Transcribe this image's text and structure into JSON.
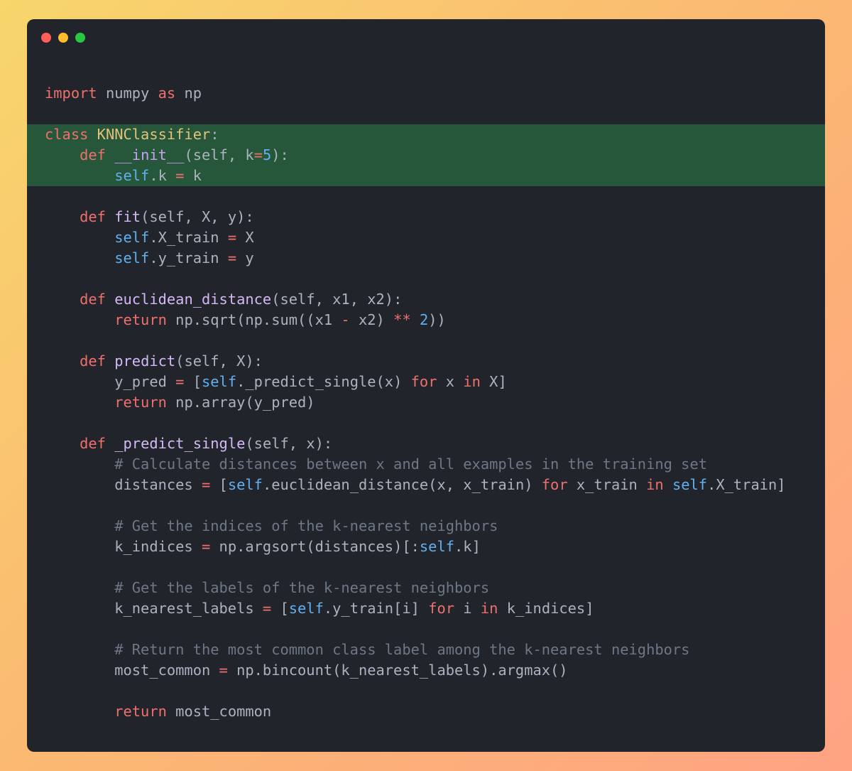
{
  "window": {
    "controls": [
      {
        "name": "close",
        "color": "#ff5f57"
      },
      {
        "name": "minimize",
        "color": "#febc2e"
      },
      {
        "name": "maximize",
        "color": "#28c840"
      }
    ]
  },
  "colors": {
    "background_gradient": [
      "#f8d66c",
      "#fbb872",
      "#ffa383"
    ],
    "window": "#21252b",
    "highlight": "#27573a",
    "keyword": "#ef6f6c",
    "self_and_numbers": "#61afef",
    "function_names": "#d4b8f5",
    "class_name": "#e5c07b",
    "comment": "#6d7785",
    "plain_text": "#abb2bf"
  },
  "code": {
    "language": "python",
    "highlighted_lines": [
      2,
      3,
      4
    ],
    "lines": [
      [
        {
          "t": "import",
          "c": "kw"
        },
        {
          "t": " numpy ",
          "c": "pl"
        },
        {
          "t": "as",
          "c": "kw"
        },
        {
          "t": " np",
          "c": "pl"
        }
      ],
      [],
      [
        {
          "t": "class",
          "c": "kw"
        },
        {
          "t": " ",
          "c": "pl"
        },
        {
          "t": "KNNClassifier",
          "c": "cls"
        },
        {
          "t": ":",
          "c": "pl"
        }
      ],
      [
        {
          "t": "    ",
          "c": "pl"
        },
        {
          "t": "def",
          "c": "kw"
        },
        {
          "t": " ",
          "c": "pl"
        },
        {
          "t": "__init__",
          "c": "dunder"
        },
        {
          "t": "(self, k",
          "c": "pl"
        },
        {
          "t": "=",
          "c": "op"
        },
        {
          "t": "5",
          "c": "num"
        },
        {
          "t": "):",
          "c": "pl"
        }
      ],
      [
        {
          "t": "        ",
          "c": "pl"
        },
        {
          "t": "self",
          "c": "self"
        },
        {
          "t": ".k ",
          "c": "pl"
        },
        {
          "t": "=",
          "c": "op"
        },
        {
          "t": " k",
          "c": "pl"
        }
      ],
      [],
      [
        {
          "t": "    ",
          "c": "pl"
        },
        {
          "t": "def",
          "c": "kw"
        },
        {
          "t": " ",
          "c": "pl"
        },
        {
          "t": "fit",
          "c": "fn"
        },
        {
          "t": "(self, X, y):",
          "c": "pl"
        }
      ],
      [
        {
          "t": "        ",
          "c": "pl"
        },
        {
          "t": "self",
          "c": "self"
        },
        {
          "t": ".X_train ",
          "c": "pl"
        },
        {
          "t": "=",
          "c": "op"
        },
        {
          "t": " X",
          "c": "pl"
        }
      ],
      [
        {
          "t": "        ",
          "c": "pl"
        },
        {
          "t": "self",
          "c": "self"
        },
        {
          "t": ".y_train ",
          "c": "pl"
        },
        {
          "t": "=",
          "c": "op"
        },
        {
          "t": " y",
          "c": "pl"
        }
      ],
      [],
      [
        {
          "t": "    ",
          "c": "pl"
        },
        {
          "t": "def",
          "c": "kw"
        },
        {
          "t": " ",
          "c": "pl"
        },
        {
          "t": "euclidean_distance",
          "c": "fn"
        },
        {
          "t": "(self, x1, x2):",
          "c": "pl"
        }
      ],
      [
        {
          "t": "        ",
          "c": "pl"
        },
        {
          "t": "return",
          "c": "kw"
        },
        {
          "t": " np.sqrt(np.sum((x1 ",
          "c": "pl"
        },
        {
          "t": "-",
          "c": "op"
        },
        {
          "t": " x2) ",
          "c": "pl"
        },
        {
          "t": "**",
          "c": "op"
        },
        {
          "t": " ",
          "c": "pl"
        },
        {
          "t": "2",
          "c": "num"
        },
        {
          "t": "))",
          "c": "pl"
        }
      ],
      [],
      [
        {
          "t": "    ",
          "c": "pl"
        },
        {
          "t": "def",
          "c": "kw"
        },
        {
          "t": " ",
          "c": "pl"
        },
        {
          "t": "predict",
          "c": "fn"
        },
        {
          "t": "(self, X):",
          "c": "pl"
        }
      ],
      [
        {
          "t": "        y_pred ",
          "c": "pl"
        },
        {
          "t": "=",
          "c": "op"
        },
        {
          "t": " [",
          "c": "pl"
        },
        {
          "t": "self",
          "c": "self"
        },
        {
          "t": "._predict_single(x) ",
          "c": "pl"
        },
        {
          "t": "for",
          "c": "kw"
        },
        {
          "t": " x ",
          "c": "pl"
        },
        {
          "t": "in",
          "c": "kw"
        },
        {
          "t": " X]",
          "c": "pl"
        }
      ],
      [
        {
          "t": "        ",
          "c": "pl"
        },
        {
          "t": "return",
          "c": "kw"
        },
        {
          "t": " np.array(y_pred)",
          "c": "pl"
        }
      ],
      [],
      [
        {
          "t": "    ",
          "c": "pl"
        },
        {
          "t": "def",
          "c": "kw"
        },
        {
          "t": " ",
          "c": "pl"
        },
        {
          "t": "_predict_single",
          "c": "fn"
        },
        {
          "t": "(self, x):",
          "c": "pl"
        }
      ],
      [
        {
          "t": "        ",
          "c": "pl"
        },
        {
          "t": "# Calculate distances between x and all examples in the training set",
          "c": "cm"
        }
      ],
      [
        {
          "t": "        distances ",
          "c": "pl"
        },
        {
          "t": "=",
          "c": "op"
        },
        {
          "t": " [",
          "c": "pl"
        },
        {
          "t": "self",
          "c": "self"
        },
        {
          "t": ".euclidean_distance(x, x_train) ",
          "c": "pl"
        },
        {
          "t": "for",
          "c": "kw"
        },
        {
          "t": " x_train ",
          "c": "pl"
        },
        {
          "t": "in",
          "c": "kw"
        },
        {
          "t": " ",
          "c": "pl"
        },
        {
          "t": "self",
          "c": "self"
        },
        {
          "t": ".X_train]",
          "c": "pl"
        }
      ],
      [],
      [
        {
          "t": "        ",
          "c": "pl"
        },
        {
          "t": "# Get the indices of the k-nearest neighbors",
          "c": "cm"
        }
      ],
      [
        {
          "t": "        k_indices ",
          "c": "pl"
        },
        {
          "t": "=",
          "c": "op"
        },
        {
          "t": " np.argsort(distances)[:",
          "c": "pl"
        },
        {
          "t": "self",
          "c": "self"
        },
        {
          "t": ".k]",
          "c": "pl"
        }
      ],
      [],
      [
        {
          "t": "        ",
          "c": "pl"
        },
        {
          "t": "# Get the labels of the k-nearest neighbors",
          "c": "cm"
        }
      ],
      [
        {
          "t": "        k_nearest_labels ",
          "c": "pl"
        },
        {
          "t": "=",
          "c": "op"
        },
        {
          "t": " [",
          "c": "pl"
        },
        {
          "t": "self",
          "c": "self"
        },
        {
          "t": ".y_train[i] ",
          "c": "pl"
        },
        {
          "t": "for",
          "c": "kw"
        },
        {
          "t": " i ",
          "c": "pl"
        },
        {
          "t": "in",
          "c": "kw"
        },
        {
          "t": " k_indices]",
          "c": "pl"
        }
      ],
      [],
      [
        {
          "t": "        ",
          "c": "pl"
        },
        {
          "t": "# Return the most common class label among the k-nearest neighbors",
          "c": "cm"
        }
      ],
      [
        {
          "t": "        most_common ",
          "c": "pl"
        },
        {
          "t": "=",
          "c": "op"
        },
        {
          "t": " np.bincount(k_nearest_labels).argmax()",
          "c": "pl"
        }
      ],
      [],
      [
        {
          "t": "        ",
          "c": "pl"
        },
        {
          "t": "return",
          "c": "kw"
        },
        {
          "t": " most_common",
          "c": "pl"
        }
      ]
    ]
  }
}
